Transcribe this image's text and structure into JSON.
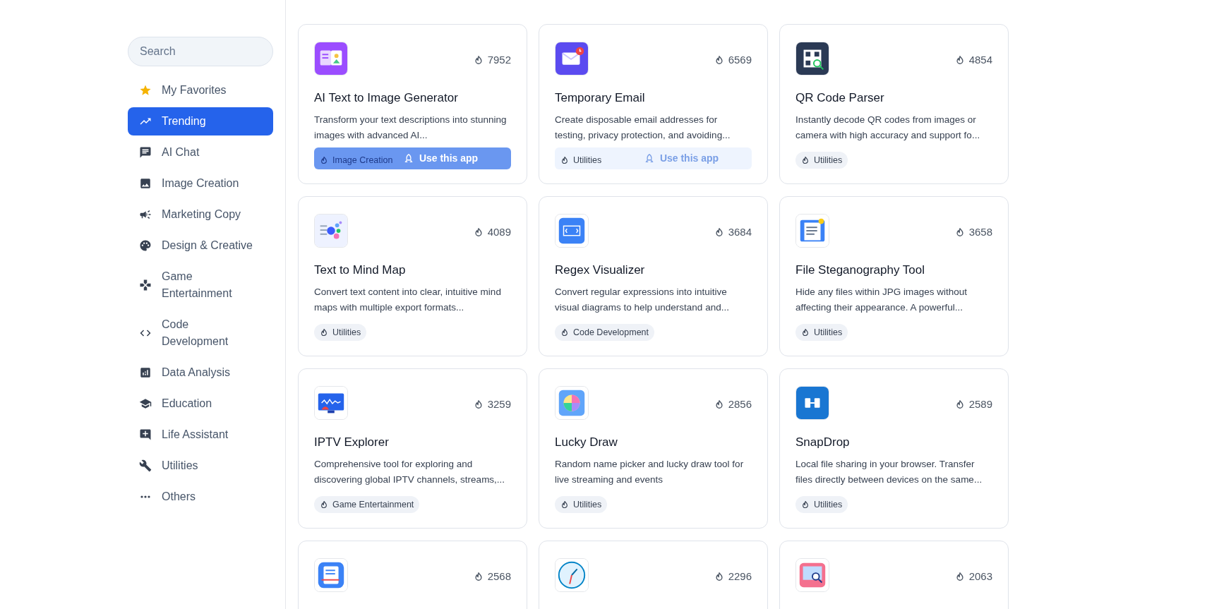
{
  "search": {
    "placeholder": "Search"
  },
  "sidebar": {
    "items": [
      {
        "label": "My Favorites",
        "selected": false
      },
      {
        "label": "Trending",
        "selected": true
      },
      {
        "label": "AI Chat",
        "selected": false
      },
      {
        "label": "Image Creation",
        "selected": false
      },
      {
        "label": "Marketing Copy",
        "selected": false
      },
      {
        "label": "Design & Creative",
        "selected": false
      },
      {
        "label": "Game Entertainment",
        "selected": false
      },
      {
        "label": "Code Development",
        "selected": false
      },
      {
        "label": "Data Analysis",
        "selected": false
      },
      {
        "label": "Education",
        "selected": false
      },
      {
        "label": "Life Assistant",
        "selected": false
      },
      {
        "label": "Utilities",
        "selected": false
      },
      {
        "label": "Others",
        "selected": false
      }
    ]
  },
  "apps": [
    {
      "title": "AI Text to Image Generator",
      "count": "7952",
      "description": "Transform your text descriptions into stunning images with advanced AI...",
      "tag": "Image Creation",
      "button": {
        "label": "Use this app",
        "kind": "solid"
      }
    },
    {
      "title": "Temporary Email",
      "count": "6569",
      "description": "Create disposable email addresses for testing, privacy protection, and avoiding...",
      "tag": "Utilities",
      "button": {
        "label": "Use this app",
        "kind": "faded"
      }
    },
    {
      "title": "QR Code Parser",
      "count": "4854",
      "description": "Instantly decode QR codes from images or camera with high accuracy and support fo...",
      "tag": "Utilities"
    },
    {
      "title": "Text to Mind Map",
      "count": "4089",
      "description": "Convert text content into clear, intuitive mind maps with multiple export formats...",
      "tag": "Utilities"
    },
    {
      "title": "Regex Visualizer",
      "count": "3684",
      "description": "Convert regular expressions into intuitive visual diagrams to help understand and...",
      "tag": "Code Development"
    },
    {
      "title": "File Steganography Tool",
      "count": "3658",
      "description": "Hide any files within JPG images without affecting their appearance. A powerful...",
      "tag": "Utilities"
    },
    {
      "title": "IPTV Explorer",
      "count": "3259",
      "description": "Comprehensive tool for exploring and discovering global IPTV channels, streams,...",
      "tag": "Game Entertainment"
    },
    {
      "title": "Lucky Draw",
      "count": "2856",
      "description": "Random name picker and lucky draw tool for live streaming and events",
      "tag": "Utilities"
    },
    {
      "title": "SnapDrop",
      "count": "2589",
      "description": "Local file sharing in your browser. Transfer files directly between devices on the same...",
      "tag": "Utilities"
    },
    {
      "count": "2568"
    },
    {
      "count": "2296"
    },
    {
      "count": "2063"
    }
  ]
}
